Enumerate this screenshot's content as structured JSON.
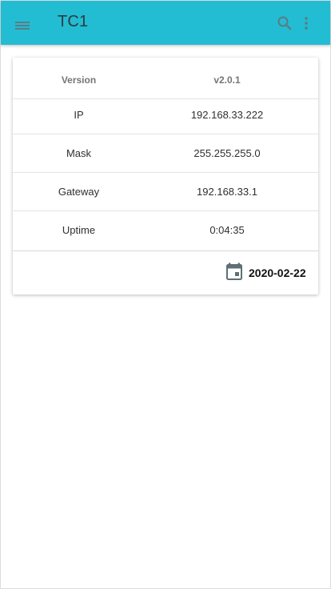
{
  "appbar": {
    "title": "TC1",
    "menu_icon": "hamburger-menu-icon",
    "search_icon": "search-icon",
    "more_icon": "more-vert-icon",
    "color": "#22bcd3"
  },
  "info": {
    "rows": [
      {
        "key": "Version",
        "value": "v2.0.1"
      },
      {
        "key": "IP",
        "value": "192.168.33.222"
      },
      {
        "key": "Mask",
        "value": "255.255.255.0"
      },
      {
        "key": "Gateway",
        "value": "192.168.33.1"
      },
      {
        "key": "Uptime",
        "value": "0:04:35"
      }
    ]
  },
  "footer": {
    "date_icon": "calendar-icon",
    "date": "2020-02-22"
  }
}
